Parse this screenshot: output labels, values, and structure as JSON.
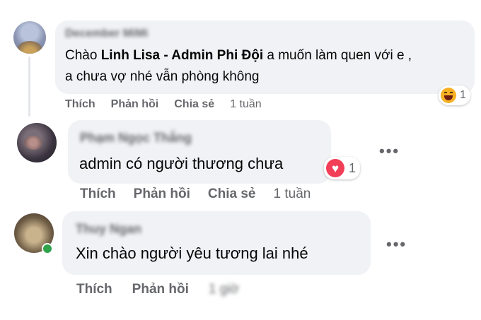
{
  "comments": [
    {
      "author": "December MiMi",
      "text_prefix": "Chào ",
      "mention": "Linh Lisa - Admin Phi Đội",
      "text_suffix": " a muốn làm quen với e ,",
      "text_line2": "a chưa vợ nhé vẫn phòng không",
      "reaction_count": "1",
      "actions": [
        "Thích",
        "Phản hồi",
        "Chia sẻ"
      ],
      "time": "1 tuần"
    },
    {
      "author": "Phạm Ngọc Thắng",
      "text": "admin có người thương chưa",
      "reaction_count": "1",
      "actions": [
        "Thích",
        "Phản hồi",
        "Chia sẻ"
      ],
      "time": "1 tuần"
    },
    {
      "author": "Thuy Ngan",
      "text": "Xin chào người yêu tương lai nhé",
      "actions": [
        "Thích",
        "Phản hồi"
      ],
      "time": "1 giờ"
    }
  ],
  "more_label": "•••",
  "colors": {
    "bubble": "#f0f2f5",
    "meta_text": "#65676b",
    "heart": "#f33e58",
    "laugh": "#f7b125",
    "online": "#31a24c"
  },
  "icons": [
    "haha-reaction-icon",
    "love-reaction-icon",
    "more-options-icon",
    "online-status-icon"
  ]
}
